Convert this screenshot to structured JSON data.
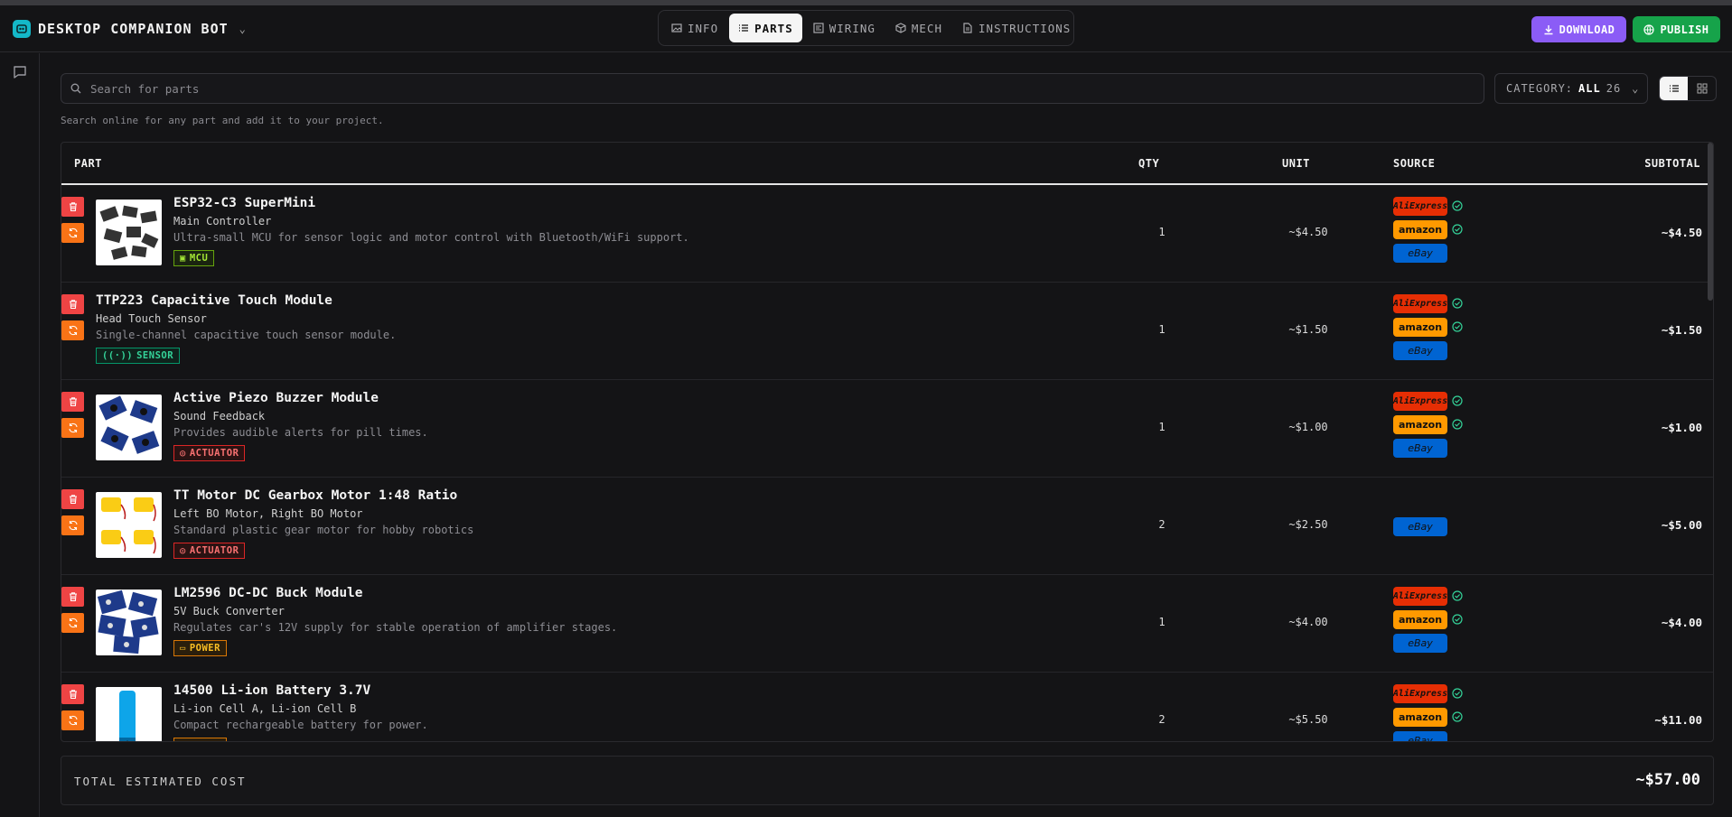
{
  "app": {
    "title": "DESKTOP COMPANION BOT",
    "accent": "#14b8c8"
  },
  "tabs": [
    {
      "label": "INFO",
      "icon": "image-icon",
      "active": false
    },
    {
      "label": "PARTS",
      "icon": "list-icon",
      "active": true
    },
    {
      "label": "WIRING",
      "icon": "circuit-icon",
      "active": false
    },
    {
      "label": "MECH",
      "icon": "cube-icon",
      "active": false
    },
    {
      "label": "INSTRUCTIONS",
      "icon": "document-icon",
      "active": false
    }
  ],
  "actions": {
    "download_label": "DOWNLOAD",
    "publish_label": "PUBLISH",
    "download_color": "#8b5cf6",
    "publish_color": "#16a34a"
  },
  "search": {
    "placeholder": "Search for parts",
    "value": "",
    "hint": "Search online for any part and add it to your project."
  },
  "category": {
    "label": "CATEGORY:",
    "value": "ALL",
    "count": "26"
  },
  "table": {
    "headers": {
      "part": "PART",
      "qty": "QTY",
      "unit": "UNIT",
      "source": "SOURCE",
      "subtotal": "SUBTOTAL"
    },
    "rows": [
      {
        "name": "ESP32-C3 SuperMini",
        "role": "Main Controller",
        "desc": "Ultra-small MCU for sensor logic and motor control with Bluetooth/WiFi support.",
        "tag": "MCU",
        "tag_type": "mcu",
        "has_image": true,
        "qty": "1",
        "unit": "~$4.50",
        "subtotal": "~$4.50",
        "sources": [
          "AliExpress",
          "amazon",
          "eBay"
        ],
        "verified": [
          true,
          true,
          false
        ]
      },
      {
        "name": "TTP223 Capacitive Touch Module",
        "role": "Head Touch Sensor",
        "desc": "Single-channel capacitive touch sensor module.",
        "tag": "SENSOR",
        "tag_type": "sensor",
        "has_image": false,
        "qty": "1",
        "unit": "~$1.50",
        "subtotal": "~$1.50",
        "sources": [
          "AliExpress",
          "amazon",
          "eBay"
        ],
        "verified": [
          true,
          true,
          false
        ]
      },
      {
        "name": "Active Piezo Buzzer Module",
        "role": "Sound Feedback",
        "desc": "Provides audible alerts for pill times.",
        "tag": "ACTUATOR",
        "tag_type": "actuator",
        "has_image": true,
        "qty": "1",
        "unit": "~$1.00",
        "subtotal": "~$1.00",
        "sources": [
          "AliExpress",
          "amazon",
          "eBay"
        ],
        "verified": [
          true,
          true,
          false
        ]
      },
      {
        "name": "TT Motor DC Gearbox Motor 1:48 Ratio",
        "role": "Left BO Motor, Right BO Motor",
        "desc": "Standard plastic gear motor for hobby robotics",
        "tag": "ACTUATOR",
        "tag_type": "actuator",
        "has_image": true,
        "qty": "2",
        "unit": "~$2.50",
        "subtotal": "~$5.00",
        "sources": [
          "eBay"
        ],
        "verified": [
          false
        ]
      },
      {
        "name": "LM2596 DC-DC Buck Module",
        "role": "5V Buck Converter",
        "desc": "Regulates car's 12V supply for stable operation of amplifier stages.",
        "tag": "POWER",
        "tag_type": "power",
        "has_image": true,
        "qty": "1",
        "unit": "~$4.00",
        "subtotal": "~$4.00",
        "sources": [
          "AliExpress",
          "amazon",
          "eBay"
        ],
        "verified": [
          true,
          true,
          false
        ]
      },
      {
        "name": "14500 Li-ion Battery 3.7V",
        "role": "Li-ion Cell A, Li-ion Cell B",
        "desc": "Compact rechargeable battery for power.",
        "tag": "POWER",
        "tag_type": "power",
        "has_image": true,
        "qty": "2",
        "unit": "~$5.50",
        "subtotal": "~$11.00",
        "sources": [
          "AliExpress",
          "amazon",
          "eBay"
        ],
        "verified": [
          true,
          true,
          false
        ]
      }
    ]
  },
  "total": {
    "label": "TOTAL ESTIMATED COST",
    "value": "~$57.00"
  }
}
